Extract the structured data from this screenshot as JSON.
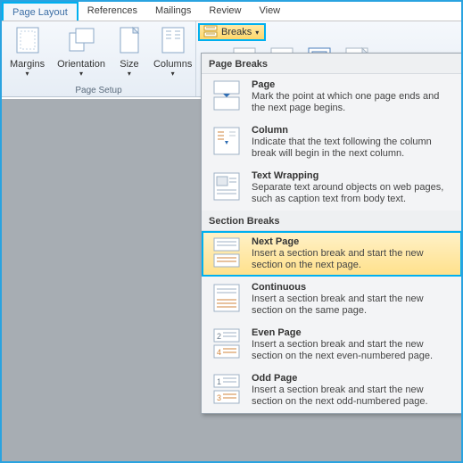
{
  "tabs": {
    "page_layout": "Page Layout",
    "references": "References",
    "mailings": "Mailings",
    "review": "Review",
    "view": "View"
  },
  "ribbon": {
    "page_setup": {
      "label": "Page Setup",
      "margins": "Margins",
      "orientation": "Orientation",
      "size": "Size",
      "columns": "Columns"
    },
    "breaks_button": "Breaks"
  },
  "dropdown": {
    "section1": "Page Breaks",
    "page": {
      "title": "Page",
      "desc": "Mark the point at which one page ends and the next page begins."
    },
    "column": {
      "title": "Column",
      "desc": "Indicate that the text following the column break will begin in the next column."
    },
    "text_wrapping": {
      "title": "Text Wrapping",
      "desc": "Separate text around objects on web pages, such as caption text from body text."
    },
    "section2": "Section Breaks",
    "next_page": {
      "title": "Next Page",
      "desc": "Insert a section break and start the new section on the next page."
    },
    "continuous": {
      "title": "Continuous",
      "desc": "Insert a section break and start the new section on the same page."
    },
    "even_page": {
      "title": "Even Page",
      "desc": "Insert a section break and start the new section on the next even-numbered page."
    },
    "odd_page": {
      "title": "Odd Page",
      "desc": "Insert a section break and start the new section on the next odd-numbered page."
    }
  }
}
